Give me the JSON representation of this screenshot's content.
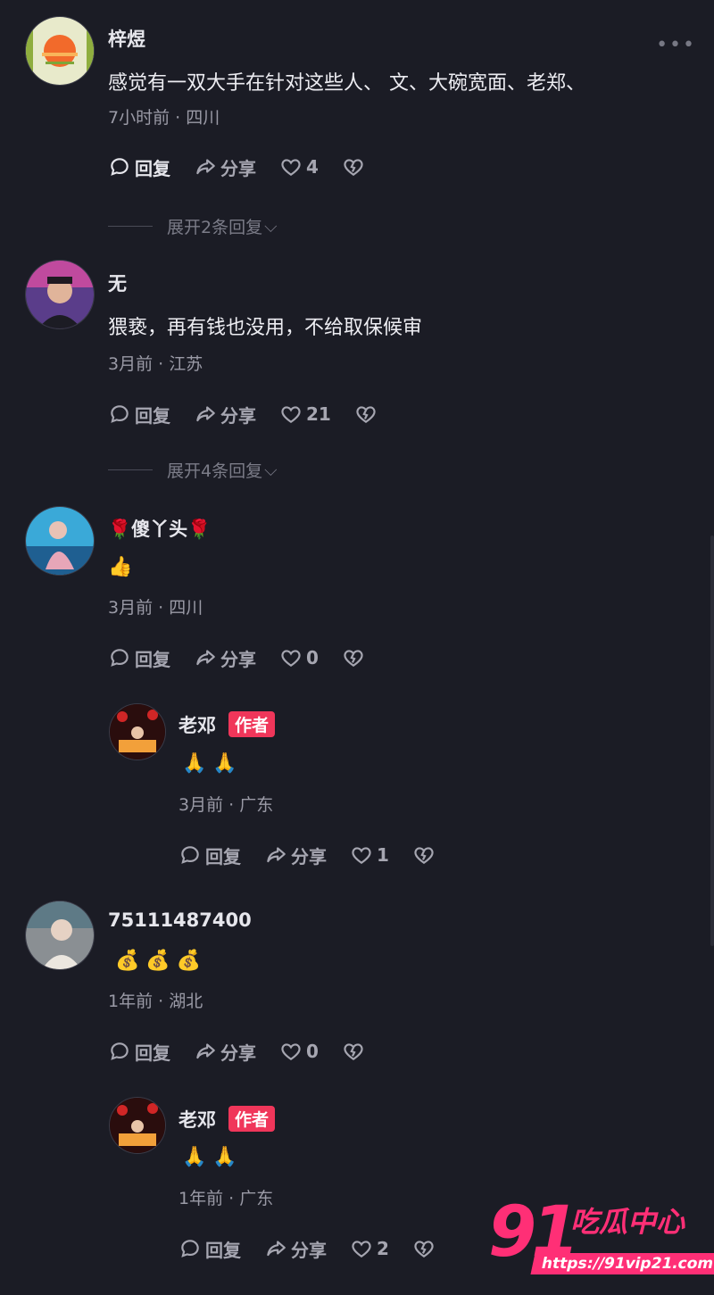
{
  "labels": {
    "reply": "回复",
    "share": "分享",
    "author_badge": "作者"
  },
  "comments": [
    {
      "user": "梓煜",
      "text": "感觉有一双大手在针对这些人、 文、大碗宽面、老郑、",
      "meta": "7小时前 · 四川",
      "likes": "4",
      "expand": "展开2条回复"
    },
    {
      "user": "无",
      "text": "猥亵，再有钱也没用，不给取保候审",
      "meta": "3月前 · 江苏",
      "likes": "21",
      "expand": "展开4条回复"
    },
    {
      "user": "🌹傻丫头🌹",
      "text": "👍",
      "meta": "3月前 · 四川",
      "likes": "0"
    },
    {
      "user": "老邓",
      "text": "🙏 🙏",
      "meta": "3月前 · 广东",
      "likes": "1"
    },
    {
      "user": "75111487400",
      "text": "💰 💰 💰",
      "meta": "1年前 · 湖北",
      "likes": "0"
    },
    {
      "user": "老邓",
      "text": "🙏 🙏",
      "meta": "1年前 · 广东",
      "likes": "2"
    }
  ],
  "more_icon": "more-dots-icon",
  "watermark": {
    "number": "91",
    "brand": "吃瓜中心",
    "url": "https://91vip21.com"
  },
  "colors": {
    "background": "#1b1c25",
    "accent": "#f0365a",
    "watermark": "#ff2f76"
  }
}
